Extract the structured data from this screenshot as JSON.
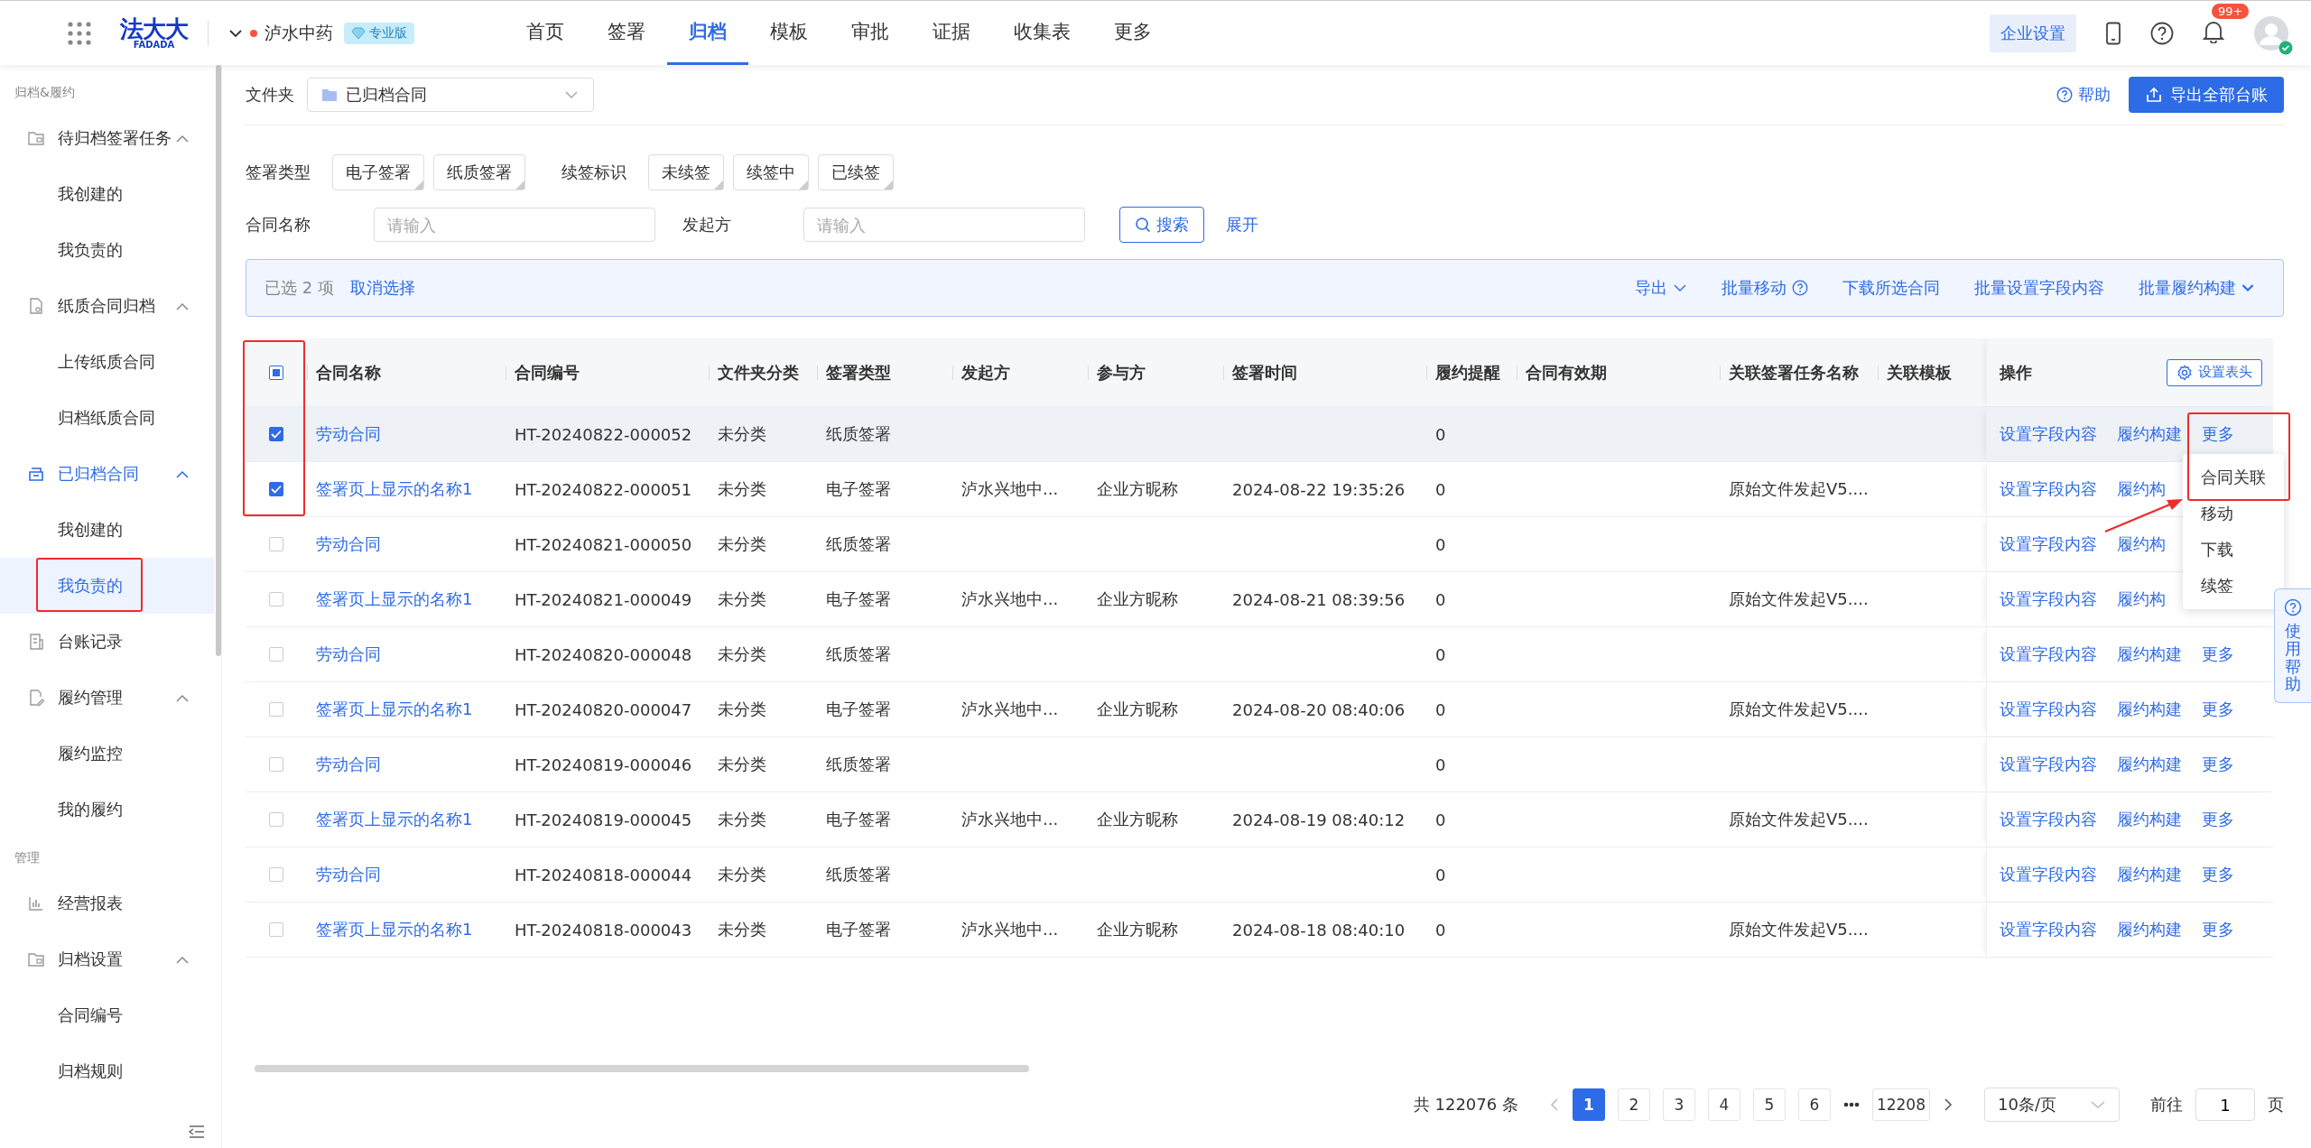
{
  "header": {
    "logo": {
      "name": "法大大",
      "sub": "FADADA"
    },
    "org": {
      "name": "泸水中药",
      "edition": "专业版"
    },
    "nav": [
      {
        "label": "首页",
        "selected": false
      },
      {
        "label": "签署",
        "selected": false
      },
      {
        "label": "归档",
        "selected": true
      },
      {
        "label": "模板",
        "selected": false
      },
      {
        "label": "审批",
        "selected": false
      },
      {
        "label": "证据",
        "selected": false
      },
      {
        "label": "收集表",
        "selected": false
      },
      {
        "label": "更多",
        "selected": false
      }
    ],
    "settings_button": "企业设置",
    "notification_badge": "99+"
  },
  "sidebar": {
    "groups": [
      {
        "title": "归档&履约",
        "items": [
          {
            "label": "待归档签署任务",
            "selected": false,
            "expanded": true,
            "children": [
              {
                "label": "我创建的",
                "selected": false,
                "annotated": false
              },
              {
                "label": "我负责的",
                "selected": false,
                "annotated": false
              }
            ]
          },
          {
            "label": "纸质合同归档",
            "selected": false,
            "expanded": true,
            "children": [
              {
                "label": "上传纸质合同",
                "selected": false,
                "annotated": false
              },
              {
                "label": "归档纸质合同",
                "selected": false,
                "annotated": false
              }
            ]
          },
          {
            "label": "已归档合同",
            "selected": true,
            "expanded": true,
            "children": [
              {
                "label": "我创建的",
                "selected": false,
                "annotated": false
              },
              {
                "label": "我负责的",
                "selected": true,
                "annotated": true
              }
            ]
          },
          {
            "label": "台账记录",
            "selected": false
          },
          {
            "label": "履约管理",
            "selected": false,
            "expanded": true,
            "children": [
              {
                "label": "履约监控",
                "selected": false,
                "annotated": false
              },
              {
                "label": "我的履约",
                "selected": false,
                "annotated": false
              }
            ]
          }
        ]
      },
      {
        "title": "管理",
        "items": [
          {
            "label": "经营报表",
            "selected": false
          },
          {
            "label": "归档设置",
            "selected": false,
            "expanded": true,
            "children": [
              {
                "label": "合同编号",
                "selected": false,
                "annotated": false
              },
              {
                "label": "归档规则",
                "selected": false,
                "annotated": false
              }
            ]
          }
        ]
      }
    ]
  },
  "toolbar": {
    "folder_label": "文件夹",
    "folder_value": "已归档合同",
    "help_link": "帮助",
    "export_all_button": "导出全部台账"
  },
  "filters": {
    "sign_type": {
      "label": "签署类型",
      "options": [
        {
          "label": "电子签署",
          "selected": false
        },
        {
          "label": "纸质签署",
          "selected": false
        }
      ]
    },
    "renew": {
      "label": "续签标识",
      "options": [
        {
          "label": "未续签",
          "selected": false
        },
        {
          "label": "续签中",
          "selected": false
        },
        {
          "label": "已续签",
          "selected": false
        }
      ]
    },
    "name_field": {
      "label": "合同名称",
      "placeholder": "请输入"
    },
    "initiator_field": {
      "label": "发起方",
      "placeholder": "请输入"
    },
    "search_button": "搜索",
    "expand_link": "展开"
  },
  "selection_bar": {
    "count": "已选 2 项",
    "cancel": "取消选择",
    "actions": [
      {
        "label": "导出",
        "kind": "dropdown"
      },
      {
        "label": "批量移动",
        "kind": "help"
      },
      {
        "label": "下载所选合同",
        "kind": "plain"
      },
      {
        "label": "批量设置字段内容",
        "kind": "plain"
      },
      {
        "label": "批量履约构建",
        "kind": "chevron"
      }
    ]
  },
  "table": {
    "header_checkbox_indeterminate": true,
    "checkbox_column_annotated": true,
    "columns": [
      "合同名称",
      "合同编号",
      "文件夹分类",
      "签署类型",
      "发起方",
      "参与方",
      "签署时间",
      "履约提醒",
      "合同有效期",
      "关联签署任务名称",
      "关联模板",
      "操作"
    ],
    "settings_button": "设置表头",
    "rows": [
      {
        "selected": true,
        "highlighted": true,
        "cells": [
          "劳动合同",
          "HT-20240822-000052",
          "未分类",
          "纸质签署",
          "",
          "",
          "",
          "0",
          "",
          "",
          ""
        ],
        "actions": [
          "设置字段内容",
          "履约构建",
          "更多"
        ]
      },
      {
        "selected": true,
        "highlighted": false,
        "cells": [
          "签署页上显示的名称1",
          "HT-20240822-000051",
          "未分类",
          "电子签署",
          "泸水兴地中...",
          "企业方昵称",
          "2024-08-22 19:35:26",
          "0",
          "",
          "原始文件发起V5....",
          ""
        ],
        "actions": [
          "设置字段内容",
          "履约构"
        ]
      },
      {
        "selected": false,
        "highlighted": false,
        "cells": [
          "劳动合同",
          "HT-20240821-000050",
          "未分类",
          "纸质签署",
          "",
          "",
          "",
          "0",
          "",
          "",
          ""
        ],
        "actions": [
          "设置字段内容",
          "履约构"
        ]
      },
      {
        "selected": false,
        "highlighted": false,
        "cells": [
          "签署页上显示的名称1",
          "HT-20240821-000049",
          "未分类",
          "电子签署",
          "泸水兴地中...",
          "企业方昵称",
          "2024-08-21 08:39:56",
          "0",
          "",
          "原始文件发起V5....",
          ""
        ],
        "actions": [
          "设置字段内容",
          "履约构"
        ]
      },
      {
        "selected": false,
        "highlighted": false,
        "cells": [
          "劳动合同",
          "HT-20240820-000048",
          "未分类",
          "纸质签署",
          "",
          "",
          "",
          "0",
          "",
          "",
          ""
        ],
        "actions": [
          "设置字段内容",
          "履约构建",
          "更多"
        ]
      },
      {
        "selected": false,
        "highlighted": false,
        "cells": [
          "签署页上显示的名称1",
          "HT-20240820-000047",
          "未分类",
          "电子签署",
          "泸水兴地中...",
          "企业方昵称",
          "2024-08-20 08:40:06",
          "0",
          "",
          "原始文件发起V5....",
          ""
        ],
        "actions": [
          "设置字段内容",
          "履约构建",
          "更多"
        ]
      },
      {
        "selected": false,
        "highlighted": false,
        "cells": [
          "劳动合同",
          "HT-20240819-000046",
          "未分类",
          "纸质签署",
          "",
          "",
          "",
          "0",
          "",
          "",
          ""
        ],
        "actions": [
          "设置字段内容",
          "履约构建",
          "更多"
        ]
      },
      {
        "selected": false,
        "highlighted": false,
        "cells": [
          "签署页上显示的名称1",
          "HT-20240819-000045",
          "未分类",
          "电子签署",
          "泸水兴地中...",
          "企业方昵称",
          "2024-08-19 08:40:12",
          "0",
          "",
          "原始文件发起V5....",
          ""
        ],
        "actions": [
          "设置字段内容",
          "履约构建",
          "更多"
        ]
      },
      {
        "selected": false,
        "highlighted": false,
        "cells": [
          "劳动合同",
          "HT-20240818-000044",
          "未分类",
          "纸质签署",
          "",
          "",
          "",
          "0",
          "",
          "",
          ""
        ],
        "actions": [
          "设置字段内容",
          "履约构建",
          "更多"
        ]
      },
      {
        "selected": false,
        "highlighted": false,
        "cells": [
          "签署页上显示的名称1",
          "HT-20240818-000043",
          "未分类",
          "电子签署",
          "泸水兴地中...",
          "企业方昵称",
          "2024-08-18 08:40:10",
          "0",
          "",
          "原始文件发起V5....",
          ""
        ],
        "actions": [
          "设置字段内容",
          "履约构建",
          "更多"
        ]
      }
    ]
  },
  "more_menu": {
    "annotated": true,
    "items": [
      {
        "label": "合同关联"
      },
      {
        "label": "移动"
      },
      {
        "label": "下载"
      },
      {
        "label": "续签"
      }
    ]
  },
  "pagination": {
    "total": "共 122076 条",
    "pages": [
      {
        "label": "1",
        "selected": true
      },
      {
        "label": "2",
        "selected": false
      },
      {
        "label": "3",
        "selected": false
      },
      {
        "label": "4",
        "selected": false
      },
      {
        "label": "5",
        "selected": false
      },
      {
        "label": "6",
        "selected": false
      },
      {
        "label": "12208",
        "selected": false
      }
    ],
    "page_size": "10条/页",
    "goto_label": "前往",
    "goto_value": "1",
    "goto_suffix": "页"
  },
  "help_tab": "使用帮助"
}
